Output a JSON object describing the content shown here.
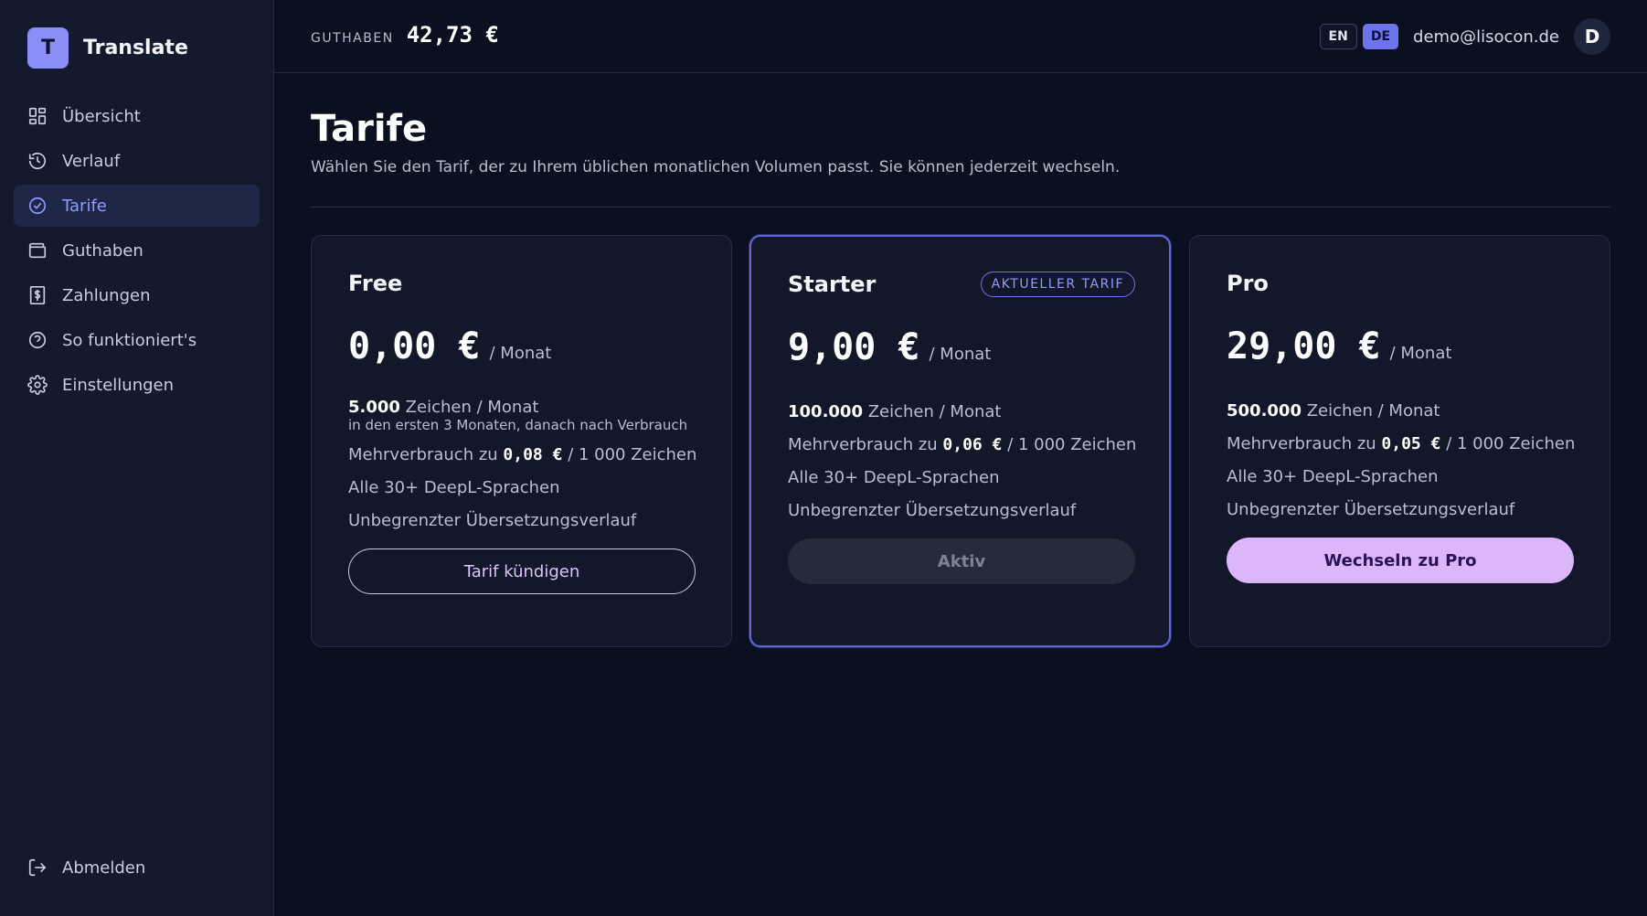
{
  "brand": {
    "logo_letter": "T",
    "name": "Translate"
  },
  "sidebar": {
    "items": [
      {
        "label": "Übersicht",
        "icon": "grid-icon",
        "active": false
      },
      {
        "label": "Verlauf",
        "icon": "history-icon",
        "active": false
      },
      {
        "label": "Tarife",
        "icon": "check-circle-icon",
        "active": true
      },
      {
        "label": "Guthaben",
        "icon": "wallet-icon",
        "active": false
      },
      {
        "label": "Zahlungen",
        "icon": "receipt-icon",
        "active": false
      },
      {
        "label": "So funktioniert's",
        "icon": "help-circle-icon",
        "active": false
      },
      {
        "label": "Einstellungen",
        "icon": "gear-icon",
        "active": false
      }
    ],
    "logout_label": "Abmelden"
  },
  "header": {
    "balance_label": "GUTHABEN",
    "balance_value": "42,73 €",
    "lang_en": "EN",
    "lang_de": "DE",
    "active_lang": "DE",
    "user_email": "demo@lisocon.de",
    "avatar_letter": "D"
  },
  "page": {
    "title": "Tarife",
    "subtitle": "Wählen Sie den Tarif, der zu Ihrem üblichen monatlichen Volumen passt. Sie können jederzeit wechseln."
  },
  "plans": [
    {
      "name": "Free",
      "price": "0,00 €",
      "period": "/ Monat",
      "chars_amount": "5.000",
      "chars_unit": "Zeichen / Monat",
      "chars_note": "in den ersten 3 Monaten, danach nach Verbrauch",
      "overage_prefix": "Mehrverbrauch zu",
      "overage_price": "0,08 €",
      "overage_suffix": "/ 1 000 Zeichen",
      "feature_languages": "Alle 30+ DeepL-Sprachen",
      "feature_history": "Unbegrenzter Übersetzungsverlauf",
      "button_label": "Tarif kündigen"
    },
    {
      "name": "Starter",
      "badge": "AKTUELLER TARIF",
      "price": "9,00 €",
      "period": "/ Monat",
      "chars_amount": "100.000",
      "chars_unit": "Zeichen / Monat",
      "overage_prefix": "Mehrverbrauch zu",
      "overage_price": "0,06 €",
      "overage_suffix": "/ 1 000 Zeichen",
      "feature_languages": "Alle 30+ DeepL-Sprachen",
      "feature_history": "Unbegrenzter Übersetzungsverlauf",
      "button_label": "Aktiv"
    },
    {
      "name": "Pro",
      "price": "29,00 €",
      "period": "/ Monat",
      "chars_amount": "500.000",
      "chars_unit": "Zeichen / Monat",
      "overage_prefix": "Mehrverbrauch zu",
      "overage_price": "0,05 €",
      "overage_suffix": "/ 1 000 Zeichen",
      "feature_languages": "Alle 30+ DeepL-Sprachen",
      "feature_history": "Unbegrenzter Übersetzungsverlauf",
      "button_label": "Wechseln zu Pro"
    }
  ],
  "colors": {
    "background": "#0b1020",
    "sidebar": "#141a2e",
    "accent": "#8f9cff",
    "primary_button": "#dbb6fb"
  }
}
